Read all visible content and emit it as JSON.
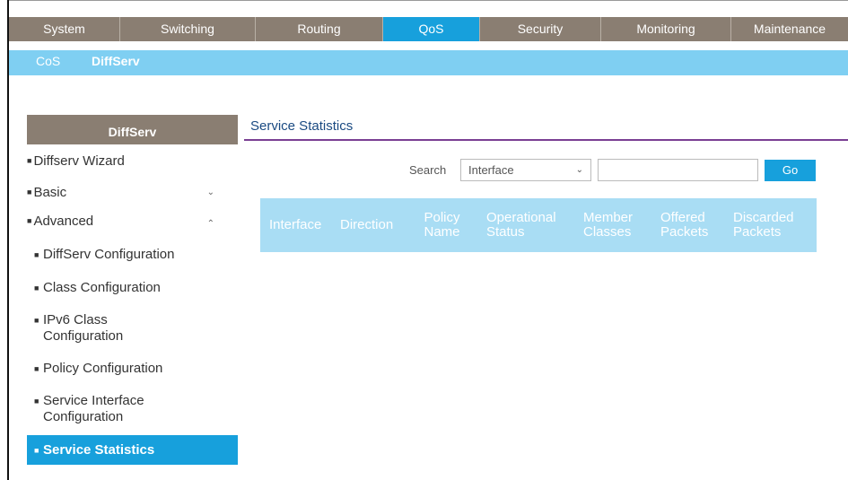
{
  "topnav": [
    "System",
    "Switching",
    "Routing",
    "QoS",
    "Security",
    "Monitoring",
    "Maintenance"
  ],
  "subnav": [
    "CoS",
    "DiffServ"
  ],
  "sidebar": {
    "title": "DiffServ",
    "items": [
      {
        "label": "Diffserv Wizard"
      },
      {
        "label": "Basic"
      },
      {
        "label": "Advanced"
      }
    ],
    "subitems": [
      {
        "label": "DiffServ Configuration"
      },
      {
        "label": "Class Configuration"
      },
      {
        "label": "IPv6 Class Configuration"
      },
      {
        "label": "Policy Configuration"
      },
      {
        "label": "Service Interface Configuration"
      },
      {
        "label": "Service Statistics"
      }
    ]
  },
  "main": {
    "title": "Service Statistics",
    "search": {
      "label": "Search",
      "selected": "Interface",
      "value": "",
      "go_label": "Go"
    },
    "table": {
      "columns": [
        "Interface",
        "Direction",
        "Policy Name",
        "Operational Status",
        "Member Classes",
        "Offered Packets",
        "Discarded Packets"
      ],
      "rows": []
    }
  },
  "colors": {
    "active_blue": "#17a0dc",
    "nav_brown": "#8a7e72",
    "subnav_blue": "#7fcff2",
    "header_cell": "#a9ddf4"
  }
}
